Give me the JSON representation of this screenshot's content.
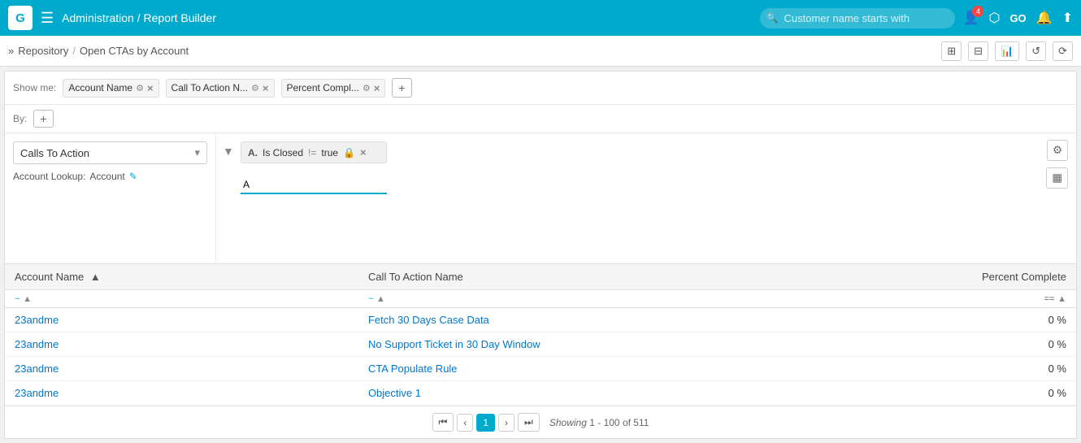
{
  "topnav": {
    "logo": "G",
    "menu_icon": "☰",
    "title": "Administration / Report Builder",
    "search_placeholder": "Customer name starts with",
    "icons": {
      "user": "👤",
      "hierarchy": "⬡",
      "go_label": "GO",
      "bell": "🔔",
      "up_arrow": "⬆"
    },
    "badge_count": "4"
  },
  "breadcrumb": {
    "arrow": "»",
    "path": [
      "Repository",
      "Open CTAs by Account"
    ]
  },
  "breadcrumb_icons": [
    "⊞",
    "⊟",
    "📊",
    "↺",
    "⟳"
  ],
  "toolbar": {
    "show_me_label": "Show me:",
    "chips": [
      {
        "label": "Account Name",
        "id": "chip-account-name"
      },
      {
        "label": "Call To Action N...",
        "id": "chip-cta-name"
      },
      {
        "label": "Percent Compl...",
        "id": "chip-percent"
      }
    ],
    "add_btn": "+"
  },
  "by_row": {
    "label": "By:",
    "add_btn": "+"
  },
  "left_panel": {
    "dropdown_label": "Calls To Action",
    "account_lookup_label": "Account Lookup:",
    "account_value": "Account",
    "edit_icon": "✎"
  },
  "filter": {
    "letter": "A.",
    "field": "Is Closed",
    "op": "!=",
    "value": "true",
    "lock_icon": "🔒",
    "del_icon": "×",
    "input_value": "A",
    "settings_icon": "⚙",
    "grid_icon": "▦"
  },
  "table": {
    "columns": [
      {
        "label": "Account Name",
        "sort": "▲",
        "id": "col-account"
      },
      {
        "label": "Call To Action Name",
        "sort": "",
        "id": "col-cta"
      },
      {
        "label": "Percent Complete",
        "sort": "",
        "id": "col-percent"
      }
    ],
    "rows": [
      {
        "account": "23andme",
        "cta": "Fetch 30 Days Case Data",
        "percent": "0 %"
      },
      {
        "account": "23andme",
        "cta": "No Support Ticket in 30 Day Window",
        "percent": "0 %"
      },
      {
        "account": "23andme",
        "cta": "CTA Populate Rule",
        "percent": "0 %"
      },
      {
        "account": "23andme",
        "cta": "Objective 1",
        "percent": "0 %"
      }
    ],
    "col1_filter_icon": "~",
    "col2_filter_icon": "~",
    "col3_filter_icon": "=="
  },
  "pagination": {
    "first_label": "⏮",
    "prev_label": "‹",
    "current_page": "1",
    "next_label": "›",
    "last_label": "⏭",
    "showing_prefix": "Showing",
    "range": "1 - 100",
    "of_label": "of",
    "total": "511"
  }
}
